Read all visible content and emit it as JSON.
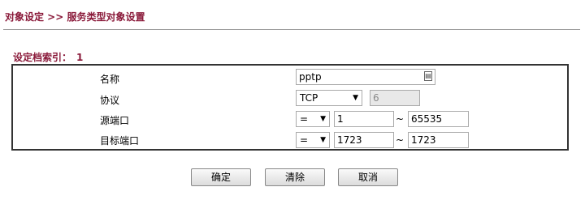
{
  "header": {
    "breadcrumb": "对象设定 >> 服务类型对象设置"
  },
  "section": {
    "label": "设定档索引：",
    "index": "1"
  },
  "form": {
    "name": {
      "label": "名称",
      "value": "pptp"
    },
    "protocol": {
      "label": "协议",
      "selected": "TCP",
      "number": "6"
    },
    "source_port": {
      "label": "源端口",
      "operator": "=",
      "start": "1",
      "separator": "~",
      "end": "65535"
    },
    "dest_port": {
      "label": "目标端口",
      "operator": "=",
      "start": "1723",
      "separator": "~",
      "end": "1723"
    }
  },
  "buttons": {
    "ok": "确定",
    "clear": "清除",
    "cancel": "取消"
  },
  "icons": {
    "caret": "▼",
    "picker": "picker-icon"
  }
}
